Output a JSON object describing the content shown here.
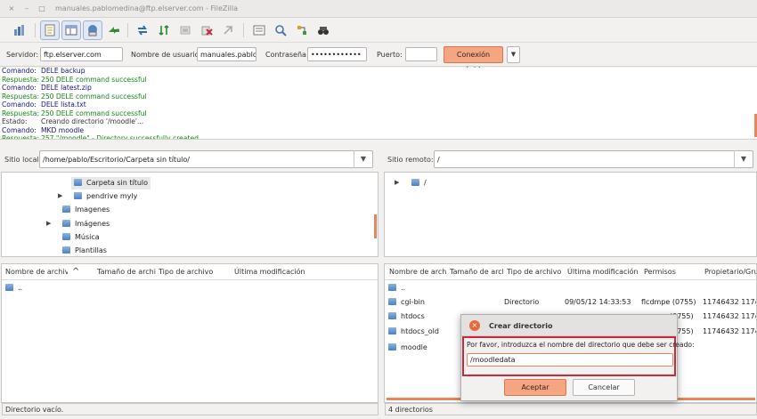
{
  "window": {
    "title": "manuales.pablomedina@ftp.elserver.com - FileZilla",
    "close_glyph": "×",
    "min_glyph": "–",
    "max_glyph": "□"
  },
  "toolbar": {
    "icons": [
      "site-manager-icon",
      "toggle-log-icon",
      "toggle-local-tree-icon",
      "toggle-remote-tree-icon",
      "transfer-queue-icon",
      "refresh-icon",
      "process-queue-icon",
      "cancel-icon",
      "disconnect-icon",
      "reconnect-icon",
      "filter-icon",
      "compare-icon",
      "sync-browse-icon",
      "search-icon"
    ]
  },
  "quickconnect": {
    "server_label": "Servidor:",
    "server_value": "ftp.elserver.com",
    "user_label": "Nombre de usuario:",
    "user_value": "manuales.pablom",
    "pass_label": "Contraseña:",
    "pass_value": "••••••••••••",
    "port_label": "Puerto:",
    "port_value": "",
    "connect_label": "Conexión rápida",
    "dropdown_glyph": "▼"
  },
  "log": [
    {
      "kind": "Comando:",
      "text": "DELE backup",
      "type": "cmd"
    },
    {
      "kind": "Respuesta:",
      "text": "250 DELE command successful",
      "type": "resp"
    },
    {
      "kind": "Comando:",
      "text": "DELE latest.zip",
      "type": "cmd"
    },
    {
      "kind": "Respuesta:",
      "text": "250 DELE command successful",
      "type": "resp"
    },
    {
      "kind": "Comando:",
      "text": "DELE lista.txt",
      "type": "cmd"
    },
    {
      "kind": "Respuesta:",
      "text": "250 DELE command successful",
      "type": "resp"
    },
    {
      "kind": "Estado:",
      "text": "Creando directorio '/moodle'...",
      "type": "state"
    },
    {
      "kind": "Comando:",
      "text": "MKD moodle",
      "type": "cmd"
    },
    {
      "kind": "Respuesta:",
      "text": "257 \"/moodle\" - Directory successfully created",
      "type": "resp"
    }
  ],
  "local": {
    "site_label": "Sitio local:",
    "site_path": "/home/pablo/Escritorio/Carpeta sin título/",
    "tree": [
      {
        "label": "Carpeta sin título",
        "selected": true
      },
      {
        "label": "pendrive myly"
      },
      {
        "label": "Imagenes"
      },
      {
        "label": "Imágenes"
      },
      {
        "label": "Música"
      },
      {
        "label": "Plantillas"
      }
    ],
    "headers": [
      "Nombre de archivo",
      "Tamaño de archivo",
      "Tipo de archivo",
      "Última modificación"
    ],
    "sort_glyph": "^",
    "rows": [
      {
        "name": ".."
      }
    ],
    "status": "Directorio vacío."
  },
  "remote": {
    "site_label": "Sitio remoto:",
    "site_path": "/",
    "tree_root": "/",
    "headers": [
      "Nombre de archivo",
      "Tamaño de archivo",
      "Tipo de archivo",
      "Última modificación",
      "Permisos",
      "Propietario/Grupo"
    ],
    "rows": [
      {
        "name": "..",
        "type": "",
        "modified": "",
        "perms": "",
        "owner": ""
      },
      {
        "name": "cgi-bin",
        "type": "Directorio",
        "modified": "09/05/12 14:33:53",
        "perms": "flcdmpe (0755)",
        "owner": "11746432 1174..."
      },
      {
        "name": "htdocs",
        "type": "",
        "modified": "",
        "perms": "(0755)",
        "owner": "11746432 1174..."
      },
      {
        "name": "htdocs_old",
        "type": "",
        "modified": "",
        "perms": "(0755)",
        "owner": "11746432 1174..."
      },
      {
        "name": "moodle",
        "type": "",
        "modified": "",
        "perms": "",
        "owner": ""
      }
    ],
    "status": "4 directorios"
  },
  "dialog": {
    "title": "Crear directorio",
    "prompt": "Por favor, introduzca el nombre del directorio que debe ser creado:",
    "input_value": "/moodledata",
    "ok_label": "Aceptar",
    "cancel_label": "Cancelar"
  },
  "colors": {
    "accent": "#f4a582",
    "highlight_border": "#d0263a",
    "command_text": "#14147e",
    "response_text": "#138a13"
  }
}
